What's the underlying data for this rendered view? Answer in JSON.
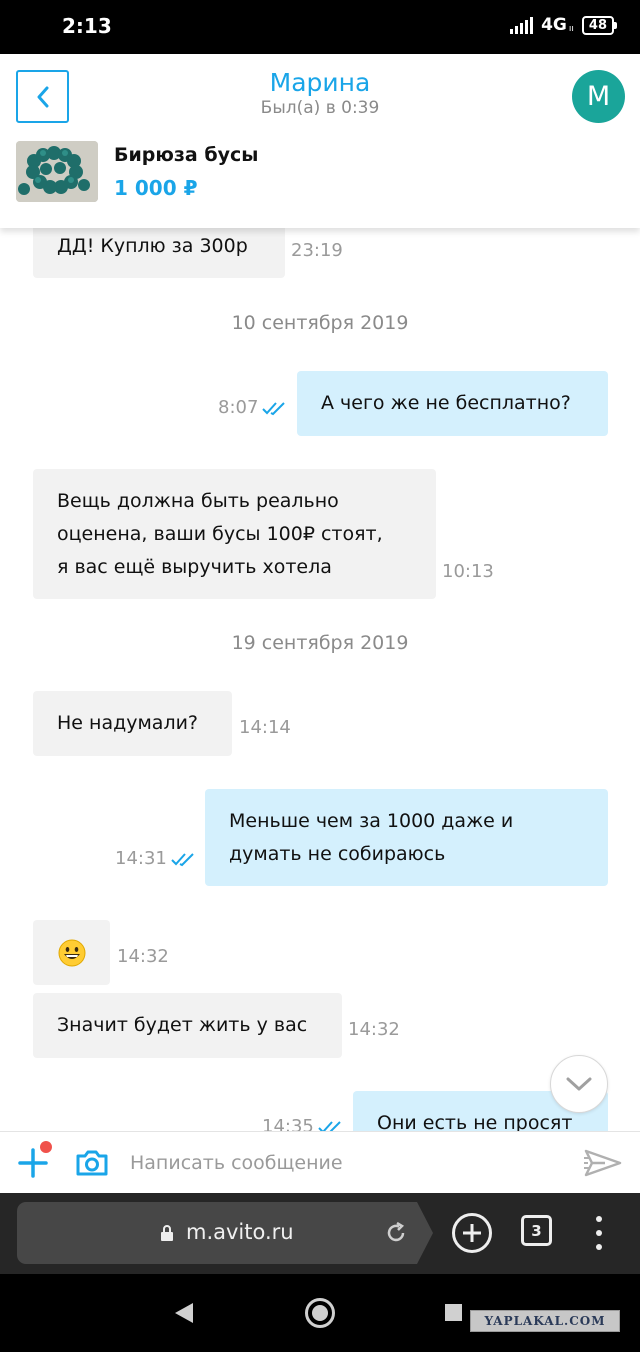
{
  "status_bar": {
    "time": "2:13",
    "network": "4G",
    "network_sup": "ıı",
    "battery": "48"
  },
  "header": {
    "contact_name": "Марина",
    "contact_status": "Был(а) в 0:39",
    "avatar_letter": "М",
    "product_title": "Бирюза бусы",
    "product_price": "1 000 ₽"
  },
  "messages": [
    {
      "direction": "in",
      "text": "ДД! Куплю за 300р",
      "time": "23:19"
    },
    {
      "type": "date",
      "text": "10 сентября 2019"
    },
    {
      "direction": "out",
      "text": "А чего же не бесплатно?",
      "time": "8:07",
      "status": "read"
    },
    {
      "direction": "in",
      "text": "Вещь должна быть реально оценена, ваши бусы 100₽ стоят, я вас ещё выручить хотела",
      "lines": [
        "Вещь должна быть реально",
        "оценена, ваши бусы 100₽ стоят,",
        "я вас ещё выручить хотела"
      ],
      "time": "10:13"
    },
    {
      "type": "date",
      "text": "19 сентября 2019"
    },
    {
      "direction": "in",
      "text": "Не надумали?",
      "time": "14:14"
    },
    {
      "direction": "out",
      "text": "Меньше чем за 1000 даже и думать не собираюсь",
      "lines": [
        "Меньше чем за 1000 даже и",
        "думать не собираюсь"
      ],
      "time": "14:31",
      "status": "read"
    },
    {
      "direction": "in",
      "text": "😀",
      "time": "14:32"
    },
    {
      "direction": "in",
      "text": "Значит будет жить у вас",
      "time": "14:32"
    },
    {
      "direction": "out",
      "text": "Они есть не просят",
      "time": "14:35",
      "status": "read"
    }
  ],
  "composer": {
    "placeholder": "Написать сообщение"
  },
  "browser": {
    "url": "m.avito.ru",
    "tab_count": "3"
  },
  "watermark": "YAPLAKAL.COM",
  "colors": {
    "accent": "#1aa5e8",
    "avatar_bg": "#1aa59a",
    "incoming_bubble": "#f2f2f2",
    "outgoing_bubble": "#d4f0fd",
    "notification_dot": "#f0514b"
  }
}
